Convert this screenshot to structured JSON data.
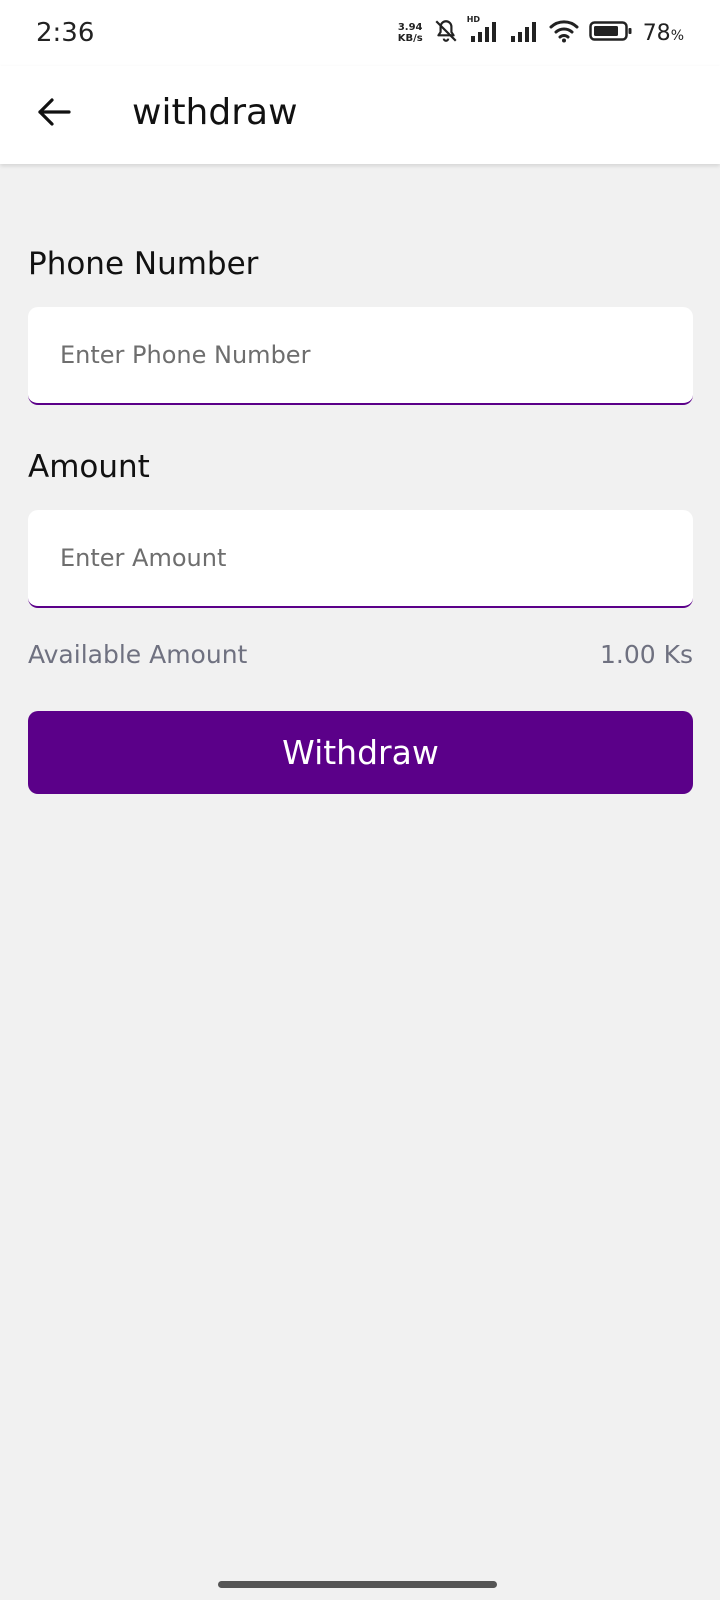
{
  "status_bar": {
    "time": "2:36",
    "net_speed_value": "3.94",
    "net_speed_unit": "KB/s",
    "hd_tag": "HD",
    "battery_value": "78",
    "battery_unit": "%",
    "icons": [
      "mute-notification-icon",
      "signal-icon",
      "signal-icon",
      "wifi-icon",
      "battery-icon"
    ]
  },
  "app_bar": {
    "title": "withdraw",
    "back_icon": "arrow-left-icon"
  },
  "form": {
    "phone": {
      "label": "Phone Number",
      "placeholder": "Enter Phone Number",
      "value": ""
    },
    "amount": {
      "label": "Amount",
      "placeholder": "Enter Amount",
      "value": ""
    },
    "available_label": "Available Amount",
    "available_value": "1.00 Ks",
    "submit_label": "Withdraw"
  },
  "colors": {
    "accent": "#5b0089",
    "background": "#f1f1f1",
    "surface": "#ffffff",
    "muted_text": "#6f7180"
  }
}
